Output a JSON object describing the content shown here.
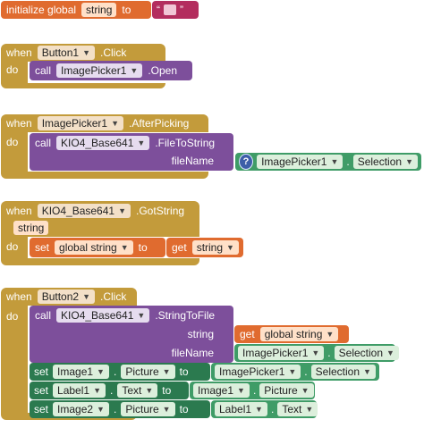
{
  "block1": {
    "initialize": "initialize global",
    "var": "string",
    "to": "to",
    "quote_open": "“",
    "quote_close": "”"
  },
  "block2": {
    "when": "when",
    "component": "Button1",
    "event": ".Click",
    "do": "do",
    "call": "call",
    "target": "ImagePicker1",
    "method": ".Open"
  },
  "block3": {
    "when": "when",
    "component": "ImagePicker1",
    "event": ".AfterPicking",
    "do": "do",
    "call": "call",
    "target": "KIO4_Base641",
    "method": ".FileToString",
    "param": "fileName",
    "q": "?",
    "src": "ImagePicker1",
    "dot": ".",
    "prop": "Selection"
  },
  "block4": {
    "when": "when",
    "component": "KIO4_Base641",
    "event": ".GotString",
    "argument": "string",
    "do": "do",
    "set": "set",
    "var": "global string",
    "to": "to",
    "get": "get",
    "getvar": "string"
  },
  "block5": {
    "when": "when",
    "component": "Button2",
    "event": ".Click",
    "do": "do",
    "call": "call",
    "target": "KIO4_Base641",
    "method": ".StringToFile",
    "p1": "string",
    "get": "get",
    "getvar": "global string",
    "p2": "fileName",
    "src": "ImagePicker1",
    "dot": ".",
    "prop": "Selection",
    "set1": {
      "set": "set",
      "comp": "Image1",
      "prop": "Picture",
      "to": "to",
      "src": "ImagePicker1",
      "dot": ".",
      "srcprop": "Selection"
    },
    "set2": {
      "set": "set",
      "comp": "Label1",
      "prop": "Text",
      "to": "to",
      "src": "Image1",
      "dot": ".",
      "srcprop": "Picture"
    },
    "set3": {
      "set": "set",
      "comp": "Image2",
      "prop": "Picture",
      "to": "to",
      "src": "Label1",
      "dot": ".",
      "srcprop": "Text"
    }
  },
  "colors": {
    "event": "#c39b3b",
    "procedure": "#7d4f9b",
    "variable": "#e06b2f",
    "component_setter": "#3f9c67",
    "text": "#b32d5e"
  }
}
